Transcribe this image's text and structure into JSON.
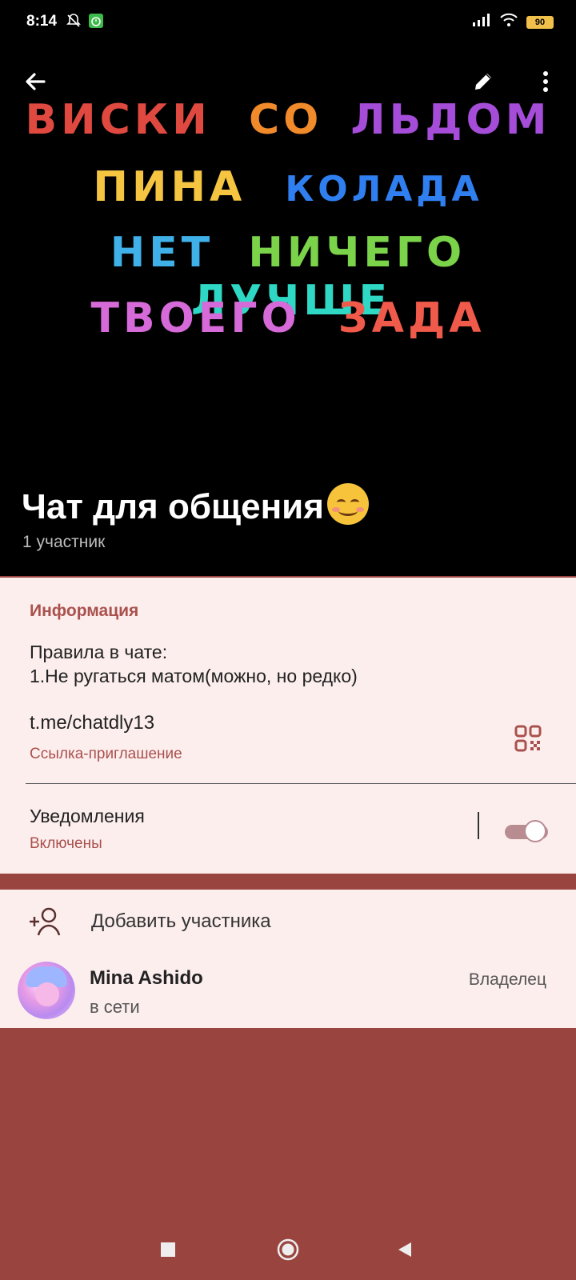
{
  "status_bar": {
    "time": "8:14",
    "battery": "90",
    "icons": [
      "bell-off-icon",
      "alarm-icon",
      "signal-icon",
      "wifi-icon",
      "battery-icon"
    ]
  },
  "header": {
    "artwork_lines": [
      {
        "words": [
          "Виски",
          "со",
          "льдом"
        ],
        "colors": [
          "#e0493f",
          "#f08a2a",
          "#a54dd9"
        ]
      },
      {
        "words": [
          "Пина",
          "колада"
        ],
        "colors": [
          "#f5c542",
          "#2f7ff0"
        ]
      },
      {
        "words": [
          "Нет",
          "ничего",
          "лучше"
        ],
        "colors": [
          "#3fb0e8",
          "#7bd34a",
          "#2ed8c4"
        ]
      },
      {
        "words": [
          "твоего",
          "зада"
        ],
        "colors": [
          "#d56ad8",
          "#f05a4a"
        ]
      }
    ],
    "title": "Чат для общения",
    "subtitle": "1 участник"
  },
  "info": {
    "section_title": "Информация",
    "about_line1": "Правила в чате:",
    "about_line2": "1.Не ругаться матом(можно, но редко)",
    "link": "t.me/chatdly13",
    "link_caption": "Ссылка-приглашение",
    "notifications_title": "Уведомления",
    "notifications_status": "Включены",
    "notifications_enabled": true
  },
  "members": {
    "add_label": "Добавить участника",
    "items": [
      {
        "name": "Mina Ashido",
        "status": "в сети",
        "role": "Владелец"
      }
    ]
  },
  "colors": {
    "accent": "#a9514d",
    "card_bg": "#fdeeee",
    "page_bg": "#9a443f",
    "header_bg": "#000000"
  }
}
